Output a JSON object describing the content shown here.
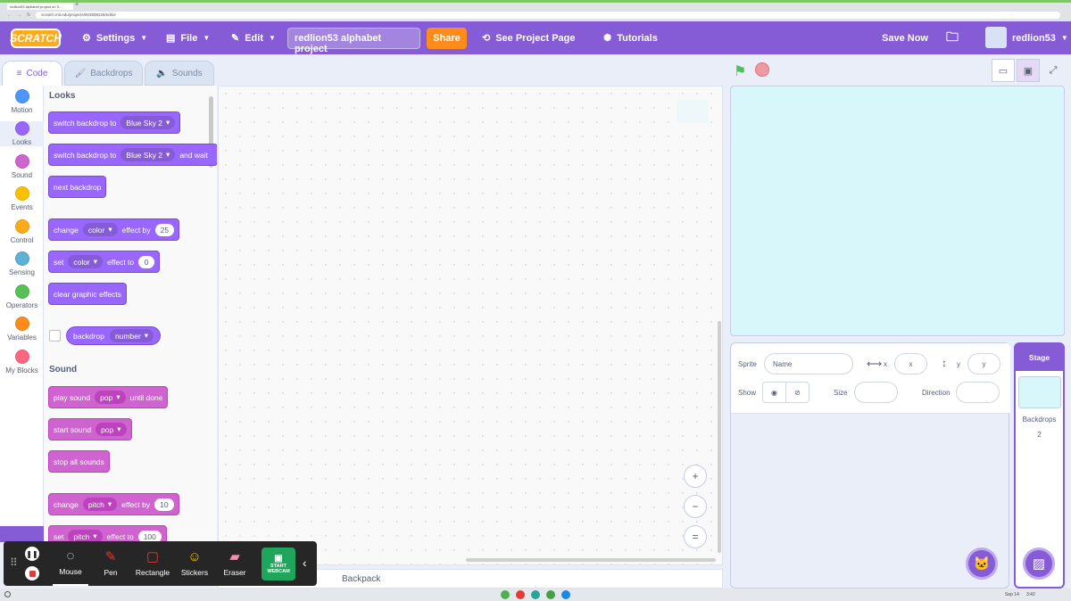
{
  "browser": {
    "tab_title": "redlion53 alphabet project on S...",
    "url": "scratch.mit.edu/projects/903598226/editor"
  },
  "menubar": {
    "logo": "SCRATCH",
    "settings": "Settings",
    "file": "File",
    "edit": "Edit",
    "project_title": "redlion53 alphabet project",
    "share": "Share",
    "see_project_page": "See Project Page",
    "tutorials": "Tutorials",
    "save_now": "Save Now",
    "username": "redlion53"
  },
  "tabs": {
    "code": "Code",
    "backdrops": "Backdrops",
    "sounds": "Sounds"
  },
  "categories": [
    {
      "label": "Motion",
      "color": "#4c97ff"
    },
    {
      "label": "Looks",
      "color": "#9966ff"
    },
    {
      "label": "Sound",
      "color": "#cf63cf"
    },
    {
      "label": "Events",
      "color": "#ffbf00"
    },
    {
      "label": "Control",
      "color": "#ffab19"
    },
    {
      "label": "Sensing",
      "color": "#5cb1d6"
    },
    {
      "label": "Operators",
      "color": "#59c059"
    },
    {
      "label": "Variables",
      "color": "#ff8c1a"
    },
    {
      "label": "My Blocks",
      "color": "#ff6680"
    }
  ],
  "palette": {
    "looks_title": "Looks",
    "b1": {
      "text": "switch backdrop to",
      "dd": "Blue Sky 2"
    },
    "b2": {
      "text": "switch backdrop to",
      "dd": "Blue Sky 2",
      "tail": "and wait"
    },
    "b3": {
      "text": "next backdrop"
    },
    "b4": {
      "text": "change",
      "dd": "color",
      "mid": "effect by",
      "num": "25"
    },
    "b5": {
      "text": "set",
      "dd": "color",
      "mid": "effect to",
      "num": "0"
    },
    "b6": {
      "text": "clear graphic effects"
    },
    "b7": {
      "text": "backdrop",
      "dd": "number"
    },
    "sound_title": "Sound",
    "s1": {
      "text": "play sound",
      "dd": "pop",
      "tail": "until done"
    },
    "s2": {
      "text": "start sound",
      "dd": "pop"
    },
    "s3": {
      "text": "stop all sounds"
    },
    "s4": {
      "text": "change",
      "dd": "pitch",
      "mid": "effect by",
      "num": "10"
    },
    "s5": {
      "text": "set",
      "dd": "pitch",
      "mid": "effect to",
      "num": "100"
    }
  },
  "workspace": {
    "backpack": "Backpack",
    "zoom_in": "+",
    "zoom_out": "−",
    "zoom_reset": "="
  },
  "sprite_info": {
    "sprite_label": "Sprite",
    "name_placeholder": "Name",
    "x_label": "x",
    "x_placeholder": "x",
    "y_label": "y",
    "y_placeholder": "y",
    "show_label": "Show",
    "size_label": "Size",
    "direction_label": "Direction"
  },
  "stage_panel": {
    "title": "Stage",
    "backdrops_label": "Backdrops",
    "backdrops_count": "2"
  },
  "annotation_toolbar": {
    "mouse": "Mouse",
    "pen": "Pen",
    "rectangle": "Rectangle",
    "stickers": "Stickers",
    "eraser": "Eraser",
    "webcam_line1": "START",
    "webcam_line2": "WEBCAM"
  },
  "taskbar": {
    "date": "Sep 14",
    "time": "3:42"
  }
}
